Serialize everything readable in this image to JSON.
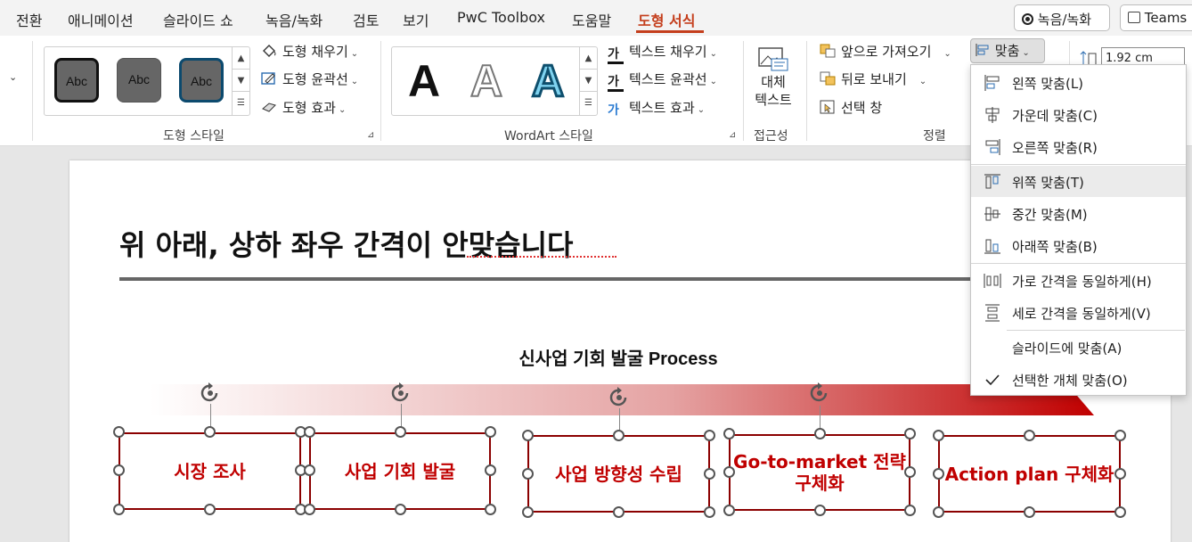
{
  "menu": {
    "tabs": [
      "전환",
      "애니메이션",
      "슬라이드 쇼",
      "녹음/녹화",
      "검토",
      "보기",
      "PwC Toolbox",
      "도움말",
      "도형 서식"
    ],
    "active_tab": "도형 서식",
    "record_button": "녹음/녹화",
    "teams_button": "Teams"
  },
  "ribbon": {
    "shape_styles": {
      "group_label": "도형 스타일",
      "swatches": [
        "Abc",
        "Abc",
        "Abc"
      ],
      "fill": "도형 채우기",
      "outline": "도형 윤곽선",
      "effects": "도형 효과"
    },
    "wordart": {
      "group_label": "WordArt 스타일",
      "letters": [
        "A",
        "A",
        "A"
      ],
      "text_fill": "텍스트 채우기",
      "text_outline": "텍스트 윤곽선",
      "text_effects": "텍스트 효과",
      "fill_icon_char": "가",
      "outline_icon_char": "가",
      "effect_icon_char": "가"
    },
    "accessibility": {
      "group_label": "접근성",
      "alt_text_line1": "대체",
      "alt_text_line2": "텍스트"
    },
    "arrange": {
      "group_label": "정렬",
      "bring_forward": "앞으로 가져오기",
      "send_backward": "뒤로 보내기",
      "selection_pane": "선택 창",
      "align": "맞춤"
    },
    "size": {
      "height_value": "1.92 cm"
    }
  },
  "align_menu": {
    "items": [
      {
        "label": "왼쪽 맞춤(L)",
        "icon": "align-left-icon"
      },
      {
        "label": "가운데 맞춤(C)",
        "icon": "align-center-icon"
      },
      {
        "label": "오른쪽 맞춤(R)",
        "icon": "align-right-icon"
      },
      {
        "label": "위쪽 맞춤(T)",
        "icon": "align-top-icon"
      },
      {
        "label": "중간 맞춤(M)",
        "icon": "align-middle-icon"
      },
      {
        "label": "아래쪽 맞춤(B)",
        "icon": "align-bottom-icon"
      },
      {
        "label": "가로 간격을 동일하게(H)",
        "icon": "distribute-horizontal-icon"
      },
      {
        "label": "세로 간격을 동일하게(V)",
        "icon": "distribute-vertical-icon"
      },
      {
        "label": "슬라이드에 맞춤(A)",
        "icon": ""
      },
      {
        "label": "선택한 개체 맞춤(O)",
        "icon": "checkmark-icon"
      }
    ],
    "hovered": "위쪽 맞춤(T)",
    "checked": "선택한 개체 맞춤(O)"
  },
  "slide": {
    "title": "위 아래, 상하 좌우 간격이 안맞습니다",
    "process_title": "신사업 기회 발굴 Process",
    "steps": [
      "시장 조사",
      "사업 기회 발굴",
      "사업 방향성 수립",
      "Go-to-market 전략\n구체화",
      "Action plan 구체화"
    ]
  },
  "colors": {
    "accent": "#c43e1c",
    "shape_text": "#c00000",
    "shape_border": "#8b0000",
    "arrow": "#c00000"
  }
}
